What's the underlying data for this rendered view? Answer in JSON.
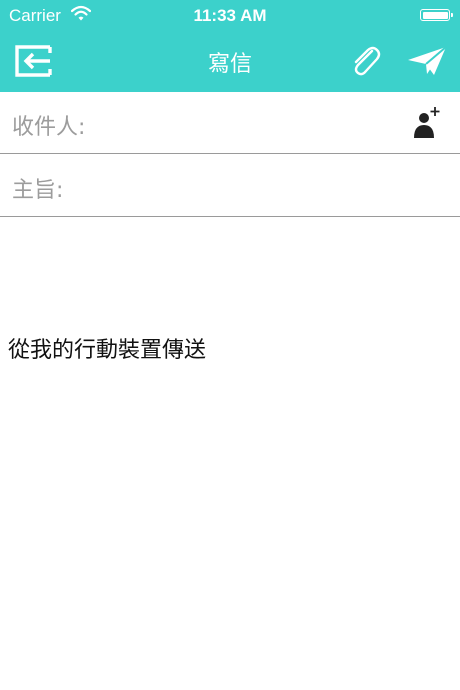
{
  "status_bar": {
    "carrier": "Carrier",
    "time": "11:33 AM"
  },
  "nav": {
    "title": "寫信"
  },
  "compose": {
    "to_label": "收件人:",
    "to_value": "",
    "subject_label": "主旨:",
    "subject_value": "",
    "signature": "從我的行動裝置傳送"
  },
  "colors": {
    "accent": "#3cd1cb",
    "label_gray": "#9c9c9c",
    "divider": "#9a9a9a"
  },
  "icons": {
    "back": "exit-icon",
    "attach": "paperclip-icon",
    "send": "paper-plane-icon",
    "add_contact": "add-contact-icon"
  }
}
